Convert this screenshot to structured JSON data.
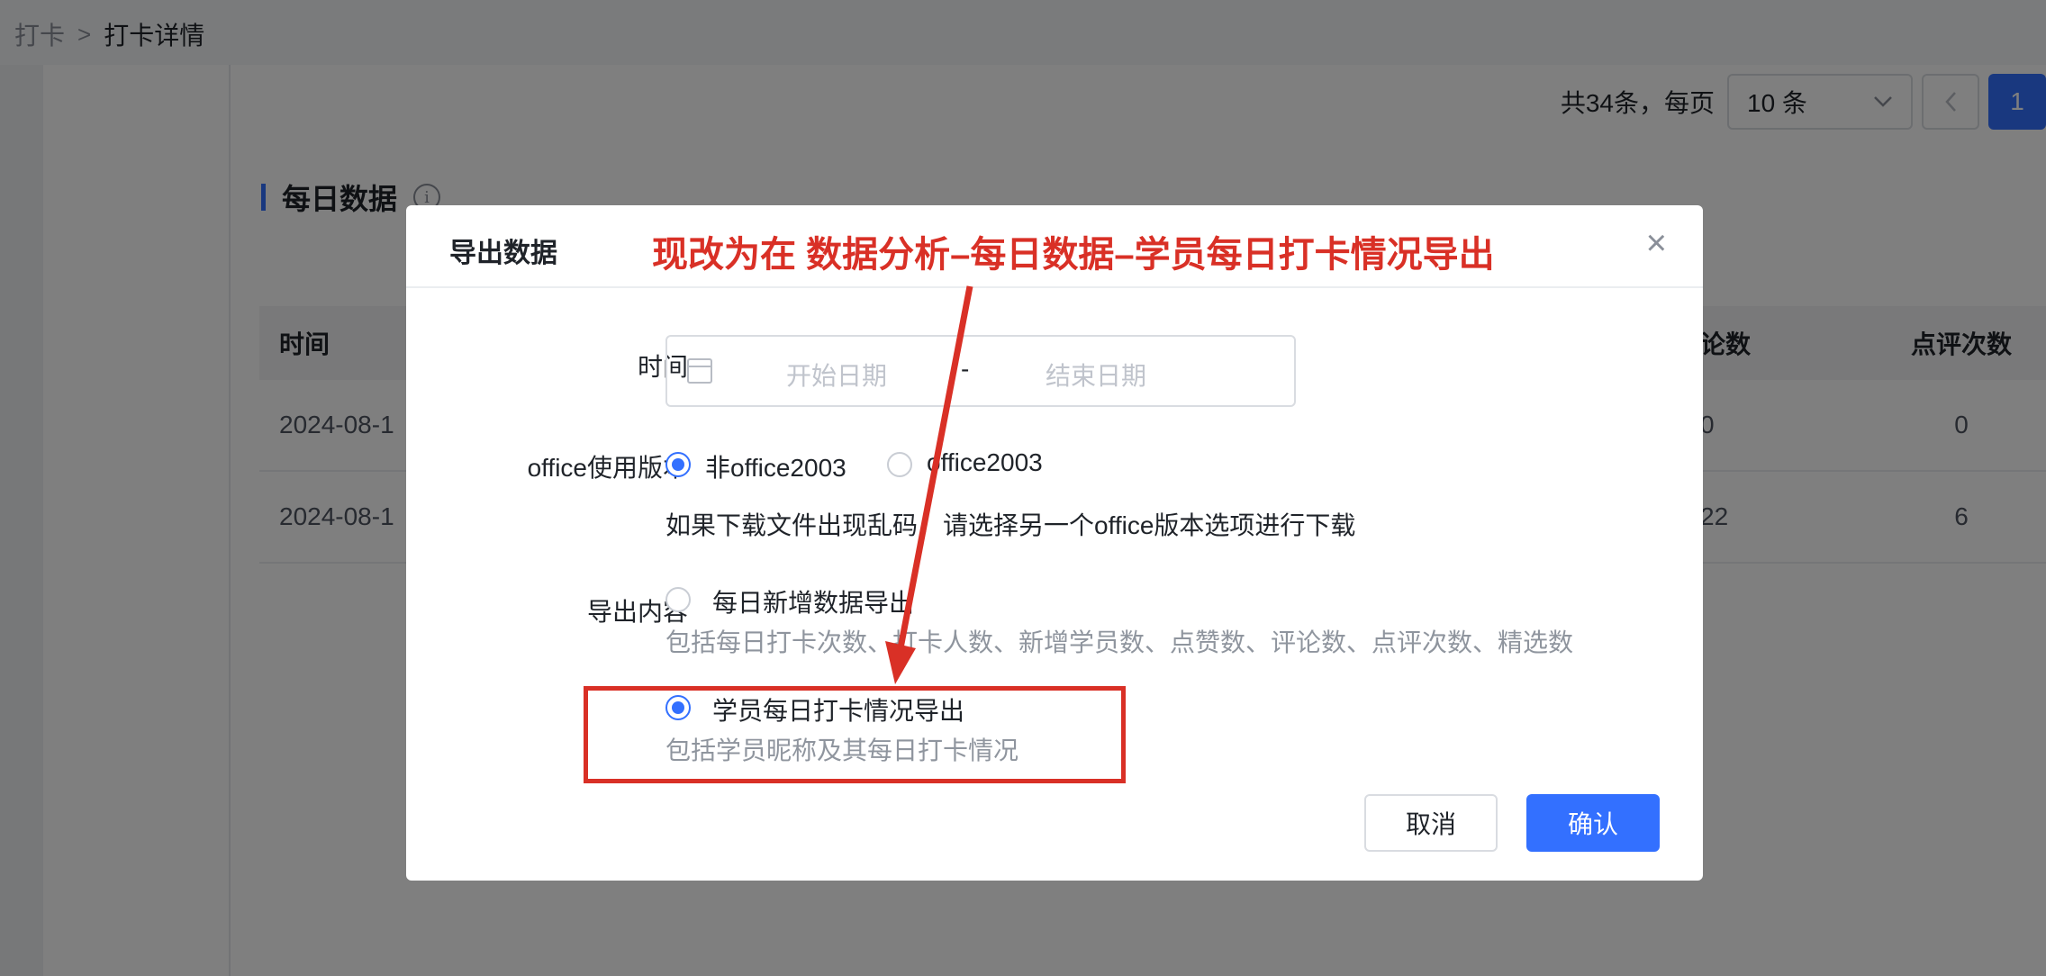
{
  "breadcrumb": {
    "parent": "打卡",
    "separator": ">",
    "current": "打卡详情"
  },
  "pagination": {
    "total_text": "共34条，每页",
    "page_size": "10 条",
    "prev_icon": "chevron-left-icon",
    "current_page": "1"
  },
  "section": {
    "title": "每日数据",
    "info_icon": "i"
  },
  "table": {
    "headers": {
      "time": "时间",
      "comments": "论数",
      "reviews": "点评次数"
    },
    "rows": [
      {
        "time": "2024-08-1",
        "comments": "0",
        "reviews": "0"
      },
      {
        "time": "2024-08-1",
        "comments": "22",
        "reviews": "6"
      }
    ]
  },
  "modal": {
    "title": "导出数据",
    "close": "×",
    "time_label": "时间",
    "start_placeholder": "开始日期",
    "range_separator": "-",
    "end_placeholder": "结束日期",
    "office_label": "office使用版本",
    "office_options": [
      "非office2003",
      "office2003"
    ],
    "office_selected": "非office2003",
    "office_hint": "如果下载文件出现乱码，请选择另一个office版本选项进行下载",
    "content_label": "导出内容",
    "content_options": [
      {
        "label": "每日新增数据导出",
        "desc": "包括每日打卡次数、打卡人数、新增学员数、点赞数、评论数、点评次数、精选数"
      },
      {
        "label": "学员每日打卡情况导出",
        "desc": "包括学员昵称及其每日打卡情况"
      }
    ],
    "content_selected": "学员每日打卡情况导出",
    "cancel": "取消",
    "confirm": "确认"
  },
  "annotation": {
    "text": "现改为在 数据分析–每日数据–学员每日打卡情况导出",
    "color": "#d93026"
  },
  "colors": {
    "primary": "#3370ff",
    "annotation": "#d93026"
  }
}
